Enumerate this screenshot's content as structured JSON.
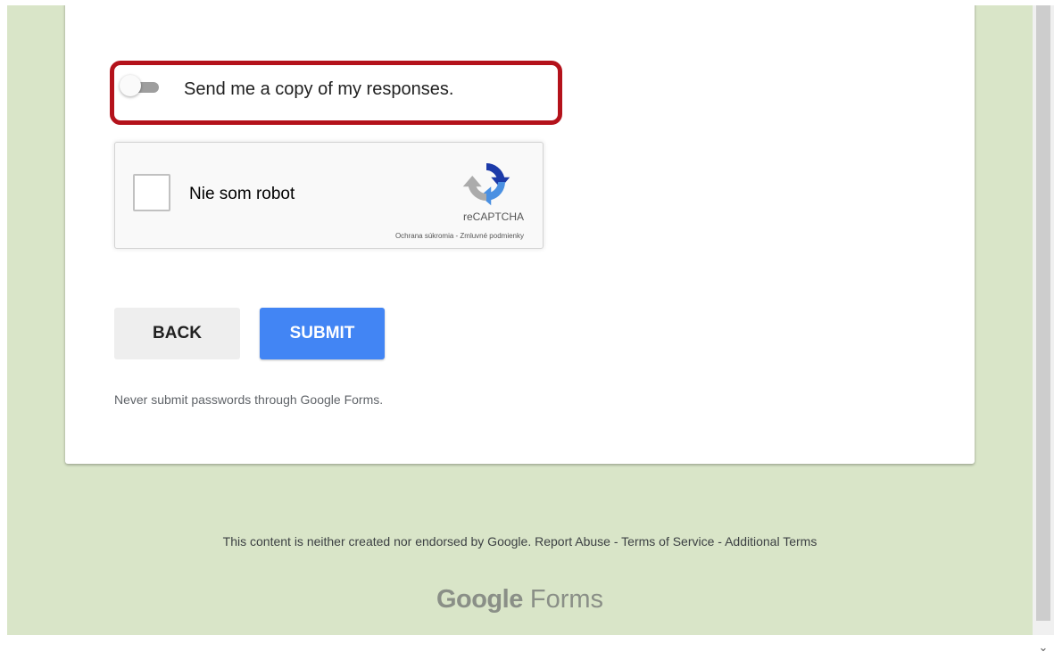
{
  "form": {
    "copy_toggle_label": "Send me a copy of my responses.",
    "copy_toggle_on": false,
    "highlight_color": "#b4121b"
  },
  "recaptcha": {
    "checkbox_label": "Nie som robot",
    "brand": "reCAPTCHA",
    "privacy_link": "Ochrana súkromia",
    "separator": " - ",
    "terms_link": "Zmluvné podmienky"
  },
  "buttons": {
    "back_label": "BACK",
    "submit_label": "SUBMIT",
    "submit_color": "#4285f4"
  },
  "warning_text": "Never submit passwords through Google Forms.",
  "footer": {
    "disclaimer": "This content is neither created nor endorsed by Google.",
    "report_abuse": "Report Abuse",
    "terms_of_service": "Terms of Service",
    "additional_terms": "Additional Terms",
    "separator": " - ",
    "logo_google": "Google",
    "logo_forms": "Forms"
  },
  "colors": {
    "page_background": "#d9e5c8",
    "card_background": "#ffffff"
  },
  "icons": {
    "recaptcha_logo": "recaptcha-logo-icon",
    "scroll_down": "chevron-down-icon"
  }
}
